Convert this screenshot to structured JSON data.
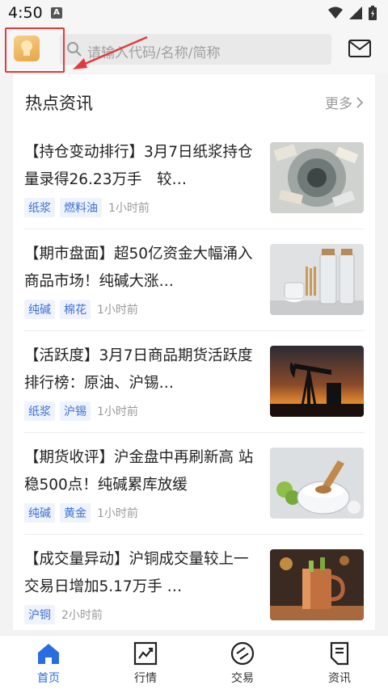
{
  "status": {
    "time": "4:50",
    "notif_letter": "A"
  },
  "header": {
    "search_placeholder": "请输入代码/名称/简称"
  },
  "section": {
    "title": "热点资讯",
    "more": "更多"
  },
  "news": [
    {
      "title": "【持仓变动排行】3月7日纸浆持仓量录得26.23万手　较…",
      "tags": [
        "纸浆",
        "燃料油"
      ],
      "time": "1小时前"
    },
    {
      "title": "【期市盘面】超50亿资金大幅涌入商品市场！纯碱大涨…",
      "tags": [
        "纯碱",
        "棉花"
      ],
      "time": "1小时前"
    },
    {
      "title": "【活跃度】3月7日商品期货活跃度排行榜：原油、沪锡…",
      "tags": [
        "纸浆",
        "沪锡"
      ],
      "time": "1小时前"
    },
    {
      "title": "【期货收评】沪金盘中再刷新高 站稳500点！纯碱累库放缓",
      "tags": [
        "纯碱",
        "黄金"
      ],
      "time": "1小时前"
    },
    {
      "title": "【成交量异动】沪铜成交量较上一交易日增加5.17万手 …",
      "tags": [
        "沪铜"
      ],
      "time": "2小时前"
    }
  ],
  "nav": [
    {
      "label": "首页",
      "icon": "home-icon",
      "active": true
    },
    {
      "label": "行情",
      "icon": "chart-icon",
      "active": false
    },
    {
      "label": "交易",
      "icon": "trade-icon",
      "active": false
    },
    {
      "label": "资讯",
      "icon": "news-icon",
      "active": false
    }
  ],
  "colors": {
    "accent": "#2a6de0",
    "annotation": "#e23a3a",
    "tag_bg": "#eef3fd",
    "tag_text": "#3d6fd6"
  }
}
